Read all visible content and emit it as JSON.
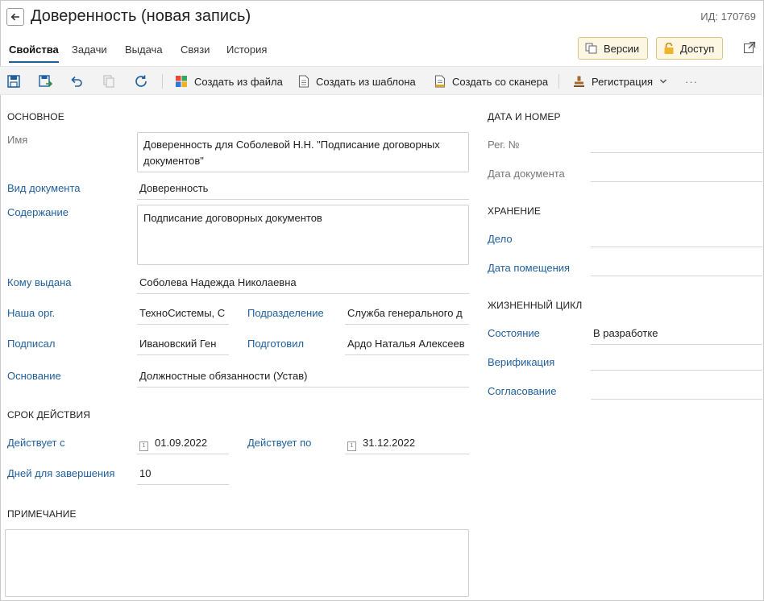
{
  "header": {
    "title": "Доверенность (новая запись)",
    "record_id": "ИД: 170769"
  },
  "tabs": [
    {
      "label": "Свойства",
      "active": true
    },
    {
      "label": "Задачи"
    },
    {
      "label": "Выдача"
    },
    {
      "label": "Связи"
    },
    {
      "label": "История"
    }
  ],
  "top_buttons": {
    "versions": "Версии",
    "access": "Доступ"
  },
  "toolbar": {
    "create_from_file": "Создать из файла",
    "create_from_template": "Создать из шаблона",
    "create_from_scanner": "Создать со сканера",
    "registration": "Регистрация",
    "more": "···"
  },
  "main": {
    "section": "Основное",
    "name_label": "Имя",
    "name_value": "Доверенность для Соболевой Н.Н. \"Подписание договорных документов\"",
    "doc_type_label": "Вид документа",
    "doc_type_value": "Доверенность",
    "content_label": "Содержание",
    "content_value": "Подписание договорных документов",
    "issued_to_label": "Кому выдана",
    "issued_to_value": "Соболева Надежда Николаевна",
    "our_org_label": "Наша орг.",
    "our_org_value": "ТехноСистемы, С",
    "department_label": "Подразделение",
    "department_value": "Служба генерального д",
    "signed_by_label": "Подписал",
    "signed_by_value": "Ивановский Ген",
    "prepared_by_label": "Подготовил",
    "prepared_by_value": "Ардо Наталья Алексеев",
    "basis_label": "Основание",
    "basis_value": "Должностные обязанности (Устав)"
  },
  "validity": {
    "section": "Срок действия",
    "valid_from_label": "Действует с",
    "valid_from_value": "01.09.2022",
    "valid_to_label": "Действует по",
    "valid_to_value": "31.12.2022",
    "days_label": "Дней для завершения",
    "days_value": "10"
  },
  "note": {
    "section": "Примечание",
    "value": ""
  },
  "date_number": {
    "section": "Дата и номер",
    "reg_no_label": "Рег. №",
    "reg_no_value": "",
    "doc_date_label": "Дата документа",
    "doc_date_value": ""
  },
  "storage": {
    "section": "Хранение",
    "case_label": "Дело",
    "case_value": "",
    "placement_date_label": "Дата помещения",
    "placement_date_value": ""
  },
  "lifecycle": {
    "section": "Жизненный цикл",
    "state_label": "Состояние",
    "state_value": "В разработке",
    "verification_label": "Верификация",
    "verification_value": "",
    "approval_label": "Согласование",
    "approval_value": ""
  },
  "colors": {
    "accent": "#1f5f9e",
    "toolbar_bg": "#f3f3f3",
    "top_button_bg": "#fdf6e3"
  }
}
